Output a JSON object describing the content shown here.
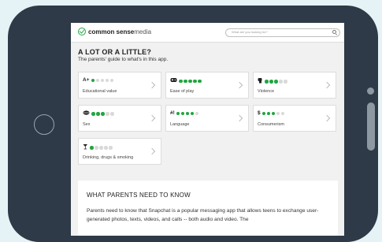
{
  "app": {
    "brand_bold": "common sense",
    "brand_light": "media"
  },
  "search": {
    "placeholder": "What are you looking for?"
  },
  "page": {
    "heading": "A LOT OR A LITTLE?",
    "subheading": "The parents' guide to what's in this app."
  },
  "cards": [
    {
      "icon": "A+",
      "label": "Educational value",
      "rating": 1,
      "max": 5
    },
    {
      "icon": "gamepad-icon",
      "label": "Ease of play",
      "rating": 5,
      "max": 5
    },
    {
      "icon": "fist-icon",
      "label": "Violence",
      "rating": 3,
      "max": 5
    },
    {
      "icon": "lips-icon",
      "label": "Sex",
      "rating": 3,
      "max": 5
    },
    {
      "icon": "#!",
      "label": "Language",
      "rating": 4,
      "max": 5
    },
    {
      "icon": "$",
      "label": "Consumerism",
      "rating": 3,
      "max": 5
    },
    {
      "icon": "drink-icon",
      "label": "Drinking, drugs & smoking",
      "rating": 1,
      "max": 5
    }
  ],
  "parents_section": {
    "title": "WHAT PARENTS NEED TO KNOW",
    "text": "Parents need to know that Snapchat is a popular messaging app that allows teens to exchange user-generated photos, texts, videos, and calls -- both audio and video. The"
  },
  "colors": {
    "rating_on": "#22a541",
    "rating_off": "#d9d9d9",
    "background": "#e5f3f6",
    "device": "#2e3a47"
  }
}
